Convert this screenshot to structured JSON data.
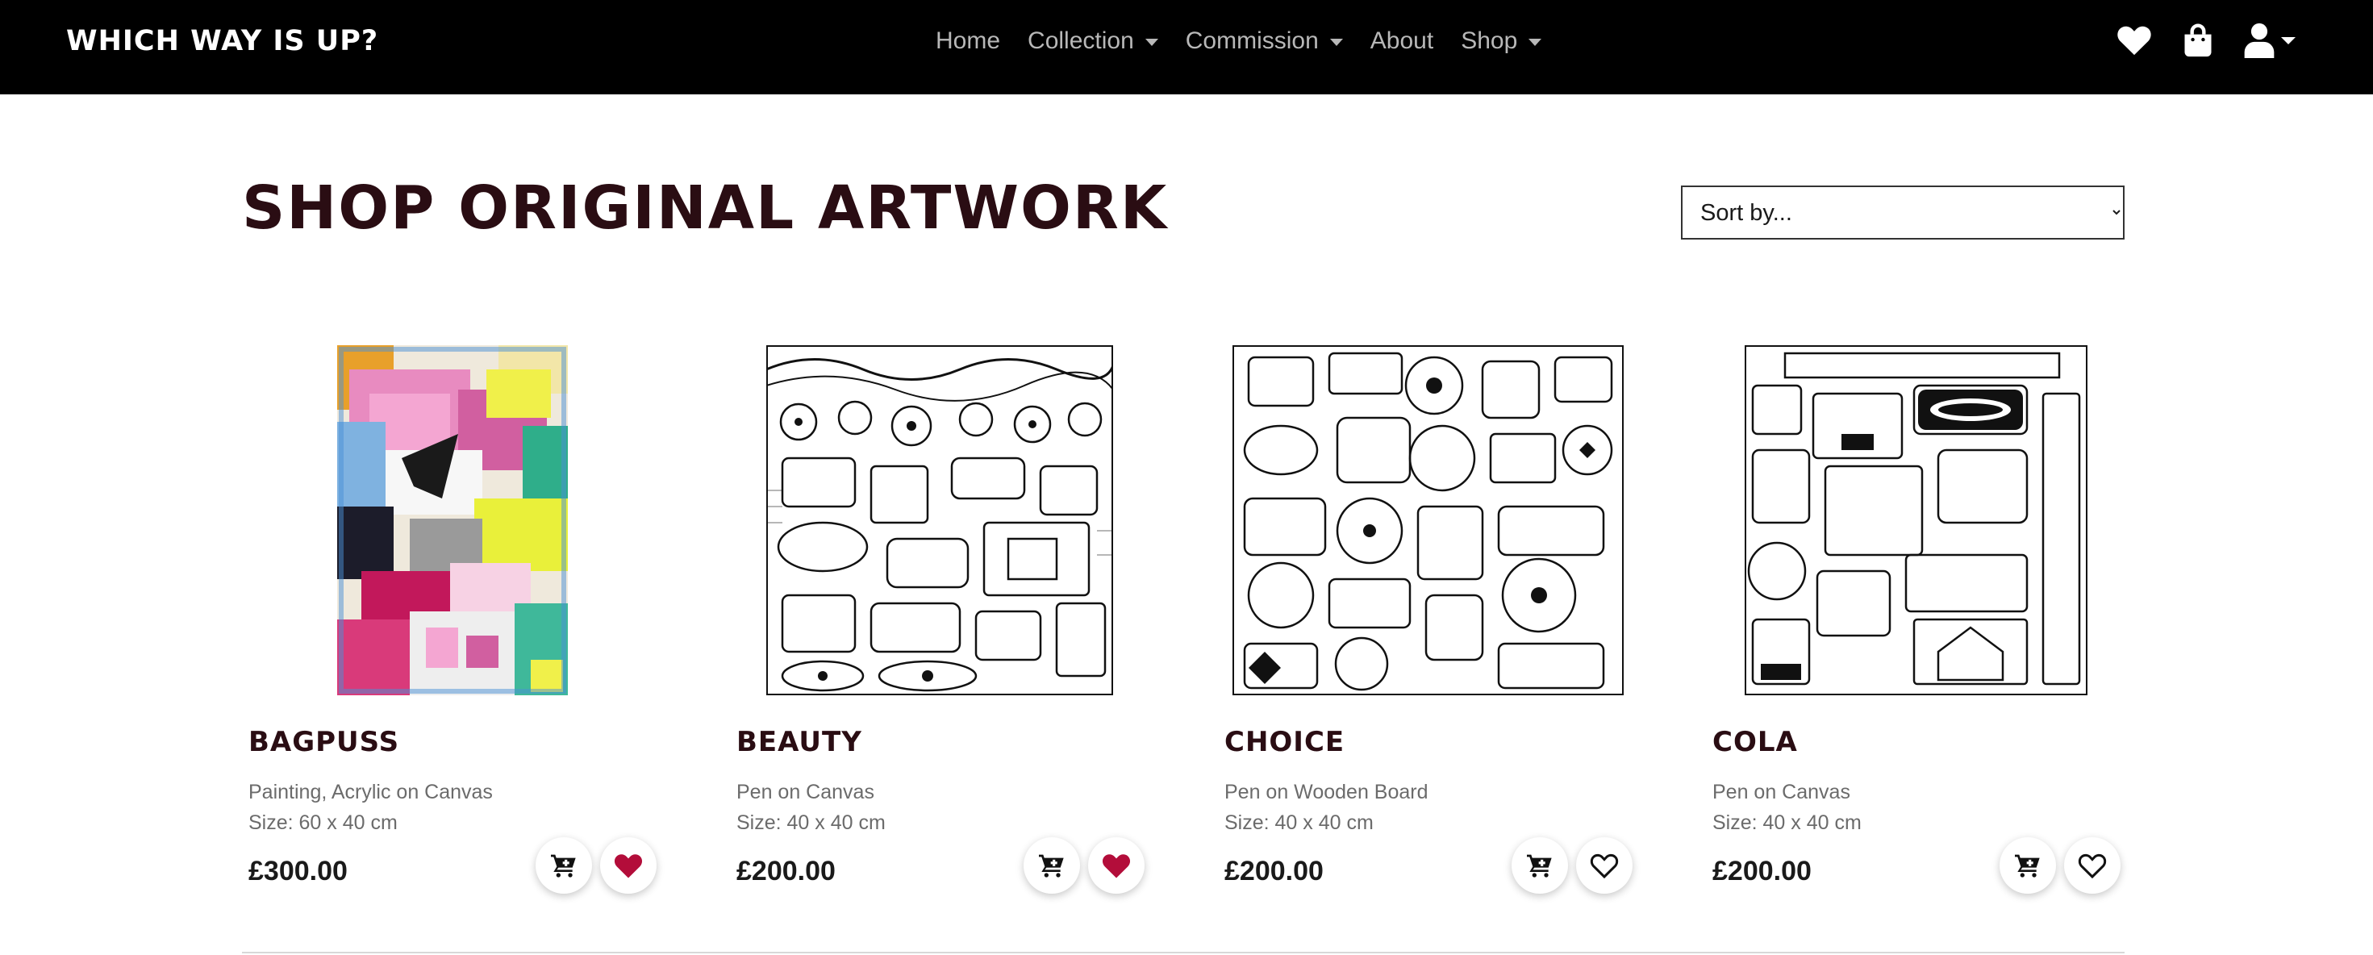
{
  "brand": "WHICH WAY IS UP?",
  "nav": {
    "links": [
      {
        "label": "Home",
        "dropdown": false
      },
      {
        "label": "Collection",
        "dropdown": true
      },
      {
        "label": "Commission",
        "dropdown": true
      },
      {
        "label": "About",
        "dropdown": false
      },
      {
        "label": "Shop",
        "dropdown": true
      }
    ],
    "icons": [
      "heart-icon",
      "shopping-bag-icon",
      "user-icon"
    ]
  },
  "page": {
    "title": "SHOP ORIGINAL ARTWORK",
    "sort": {
      "selected": "Sort by..."
    }
  },
  "products": [
    {
      "name": "BAGPUSS",
      "desc": "Painting, Acrylic on Canvas",
      "size": "Size: 60 x 40 cm",
      "price": "£300.00",
      "favorited": true
    },
    {
      "name": "BEAUTY",
      "desc": "Pen on Canvas",
      "size": "Size: 40 x 40 cm",
      "price": "£200.00",
      "favorited": true
    },
    {
      "name": "CHOICE",
      "desc": "Pen on Wooden Board",
      "size": "Size: 40 x 40 cm",
      "price": "£200.00",
      "favorited": false
    },
    {
      "name": "COLA",
      "desc": "Pen on Canvas",
      "size": "Size: 40 x 40 cm",
      "price": "£200.00",
      "favorited": false
    }
  ],
  "colors": {
    "navbar_bg": "#000000",
    "title_color": "#2a0d13",
    "favorite_red": "#b30d3a",
    "muted_text": "#6b6b6b"
  }
}
